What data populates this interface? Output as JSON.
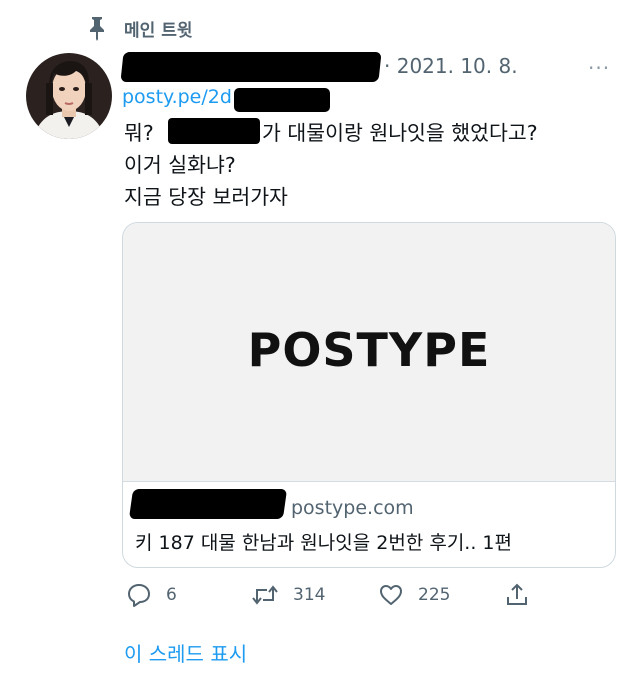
{
  "pinned": {
    "icon": "pin-icon",
    "label": "메인 트윗"
  },
  "tweet": {
    "date": "· 2021. 10. 8.",
    "more_icon": "···",
    "link": "posty.pe/2d",
    "text_line1_start": "뭐?",
    "text_line1_end": "가 대물이랑 원나잇을 했었다고?",
    "text_line2": "이거 실화냐?",
    "text_line3": "지금 당장 보러가자"
  },
  "card": {
    "logo_text": "POSTYPE",
    "domain": "postype.com",
    "title": "키 187 대물 한남과 원나잇을 2번한 후기.. 1편"
  },
  "actions": {
    "reply_count": "6",
    "retweet_count": "314",
    "like_count": "225"
  },
  "thread_link": "이 스레드 표시",
  "colors": {
    "accent": "#1d9bf0",
    "muted": "#536471",
    "text": "#0f1419"
  }
}
